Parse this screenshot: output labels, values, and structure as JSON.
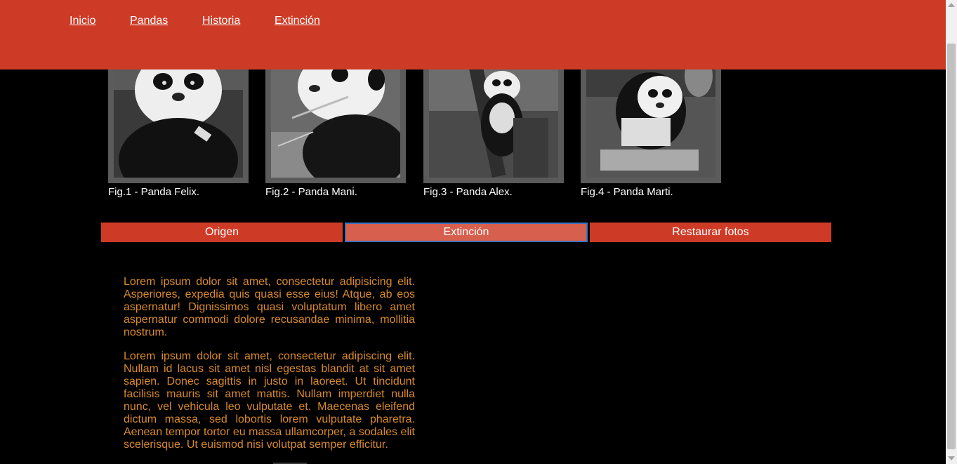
{
  "nav": {
    "items": [
      {
        "label": "Inicio"
      },
      {
        "label": "Pandas"
      },
      {
        "label": "Historia"
      },
      {
        "label": "Extinción"
      }
    ]
  },
  "gallery": {
    "figures": [
      {
        "caption": "Fig.1 - Panda Felix."
      },
      {
        "caption": "Fig.2 - Panda Mani."
      },
      {
        "caption": "Fig.3 - Panda Alex."
      },
      {
        "caption": "Fig.4 - Panda Marti."
      }
    ]
  },
  "buttons": {
    "origen": "Origen",
    "extincion": "Extinción",
    "restaurar": "Restaurar fotos"
  },
  "content": {
    "paragraphs": [
      "Lorem ipsum dolor sit amet, consectetur adipisicing elit. Asperiores, expedia quis quasi esse eius! Atque, ab eos aspernatur! Dignissimos quasi voluptatum libero amet aspernatur commodi dolore recusandae minima, mollitia nostrum.",
      "Lorem ipsum dolor sit amet, consectetur adipiscing elit. Nullam id lacus sit amet nisl egestas blandit at sit amet sapien. Donec sagittis in justo in laoreet. Ut tincidunt facilisis mauris sit amet mattis. Nullam imperdiet nulla nunc, vel vehicula leo vulputate et. Maecenas eleifend dictum massa, sed lobortis lorem vulputate pharetra. Aenean tempor tortor eu massa ullamcorper, a sodales elit scelerisque. Ut euismod nisi volutpat semper efficitur."
    ]
  },
  "colors": {
    "header": "#cd3b26",
    "button": "#cd3b26",
    "button_active": "#d65f4e",
    "text": "#d98a2a",
    "background": "#000000"
  }
}
